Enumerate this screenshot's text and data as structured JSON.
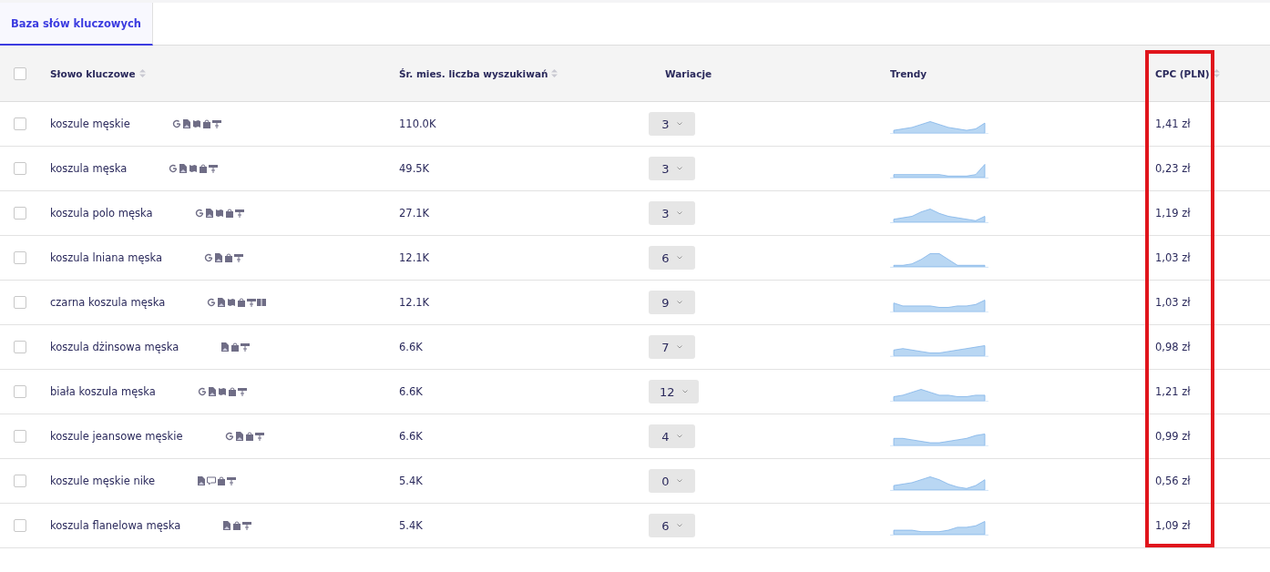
{
  "tabs": [
    {
      "label": "Baza słów kluczowych",
      "selected": true
    }
  ],
  "columns": [
    {
      "label": "Słowo kluczowe",
      "sortable": true,
      "highlighted": false
    },
    {
      "label": "Śr. mies. liczba wyszukiwań",
      "sortable": true,
      "highlighted": false
    },
    {
      "label": "Wariacje",
      "sortable": false,
      "highlighted": false
    },
    {
      "label": "Trendy",
      "sortable": false,
      "highlighted": false
    },
    {
      "label": "CPC (PLN)",
      "sortable": true,
      "highlighted": true
    }
  ],
  "select_all": {
    "checked": false
  },
  "rows": [
    {
      "checked": false,
      "keyword": "koszule męskie",
      "features": [
        {
          "kind": "google"
        },
        {
          "kind": "image"
        },
        {
          "kind": "map"
        },
        {
          "kind": "shop"
        },
        {
          "kind": "ads"
        }
      ],
      "searches": "110.0K",
      "variations": "3",
      "cpc": "1,41 zł"
    },
    {
      "checked": false,
      "keyword": "koszula męska",
      "features": [
        {
          "kind": "google"
        },
        {
          "kind": "image"
        },
        {
          "kind": "map"
        },
        {
          "kind": "shop"
        },
        {
          "kind": "ads"
        }
      ],
      "searches": "49.5K",
      "variations": "3",
      "cpc": "0,23 zł"
    },
    {
      "checked": false,
      "keyword": "koszula polo męska",
      "features": [
        {
          "kind": "google"
        },
        {
          "kind": "image"
        },
        {
          "kind": "map"
        },
        {
          "kind": "shop"
        },
        {
          "kind": "ads"
        }
      ],
      "searches": "27.1K",
      "variations": "3",
      "cpc": "1,19 zł"
    },
    {
      "checked": false,
      "keyword": "koszula lniana męska",
      "features": [
        {
          "kind": "google"
        },
        {
          "kind": "image"
        },
        {
          "kind": "shop"
        },
        {
          "kind": "ads"
        }
      ],
      "searches": "12.1K",
      "variations": "6",
      "cpc": "1,03 zł"
    },
    {
      "checked": false,
      "keyword": "czarna koszula męska",
      "features": [
        {
          "kind": "google"
        },
        {
          "kind": "image"
        },
        {
          "kind": "map"
        },
        {
          "kind": "shop"
        },
        {
          "kind": "ads"
        },
        {
          "kind": "book"
        }
      ],
      "searches": "12.1K",
      "variations": "9",
      "cpc": "1,03 zł"
    },
    {
      "checked": false,
      "keyword": "koszula dżinsowa męska",
      "features": [
        {
          "kind": "image"
        },
        {
          "kind": "shop"
        },
        {
          "kind": "ads"
        }
      ],
      "searches": "6.6K",
      "variations": "7",
      "cpc": "0,98 zł"
    },
    {
      "checked": false,
      "keyword": "biała koszula męska",
      "features": [
        {
          "kind": "google"
        },
        {
          "kind": "image"
        },
        {
          "kind": "map"
        },
        {
          "kind": "shop"
        },
        {
          "kind": "ads"
        }
      ],
      "searches": "6.6K",
      "variations": "12",
      "cpc": "1,21 zł"
    },
    {
      "checked": false,
      "keyword": "koszule jeansowe męskie",
      "features": [
        {
          "kind": "google"
        },
        {
          "kind": "image"
        },
        {
          "kind": "shop"
        },
        {
          "kind": "ads"
        }
      ],
      "searches": "6.6K",
      "variations": "4",
      "cpc": "0,99 zł"
    },
    {
      "checked": false,
      "keyword": "koszule męskie nike",
      "features": [
        {
          "kind": "image"
        },
        {
          "kind": "chat"
        },
        {
          "kind": "shop"
        },
        {
          "kind": "ads"
        }
      ],
      "searches": "5.4K",
      "variations": "0",
      "cpc": "0,56 zł"
    },
    {
      "checked": false,
      "keyword": "koszula flanelowa męska",
      "features": [
        {
          "kind": "image"
        },
        {
          "kind": "shop"
        },
        {
          "kind": "ads"
        }
      ],
      "searches": "5.4K",
      "variations": "6",
      "cpc": "1,09 zł"
    }
  ]
}
